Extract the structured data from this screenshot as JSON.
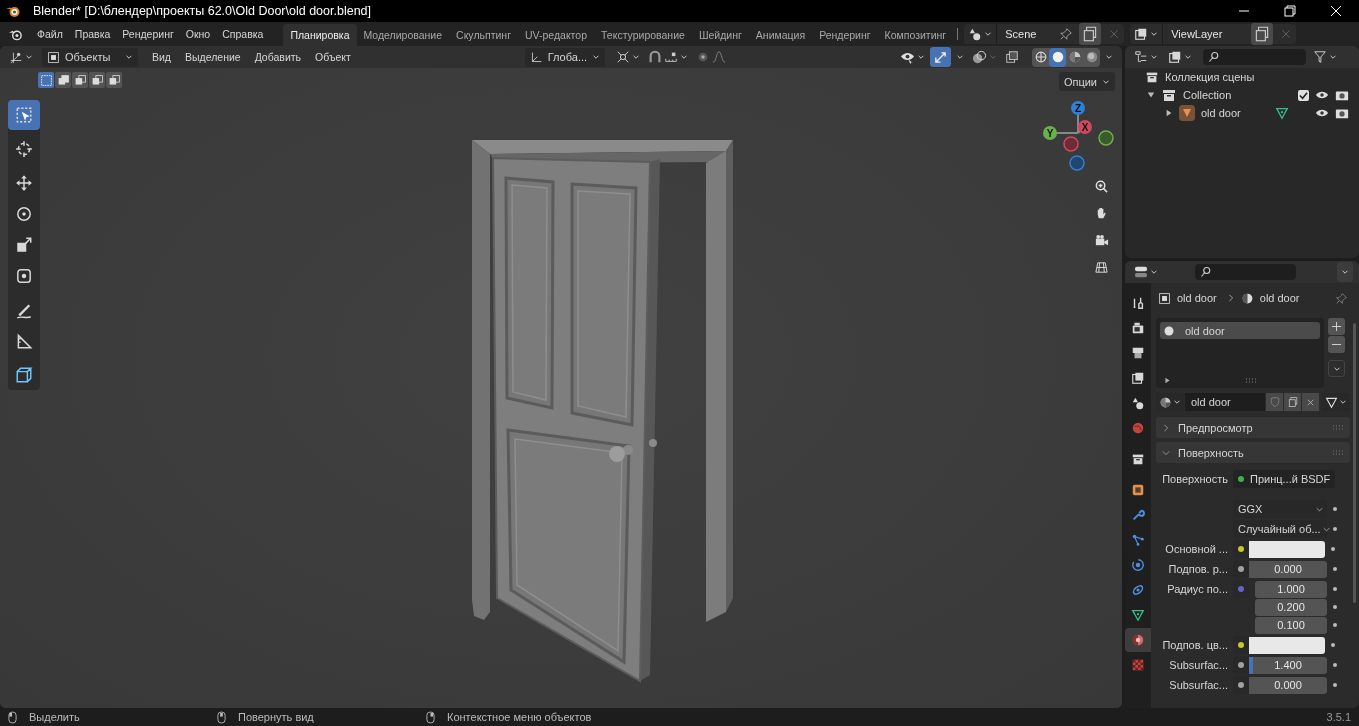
{
  "window": {
    "title": "Blender* [D:\\блендер\\проекты 62.0\\Old Door\\old door.blend]"
  },
  "menu": [
    "Файл",
    "Правка",
    "Рендеринг",
    "Окно",
    "Справка"
  ],
  "workspaces": [
    {
      "label": "Планировка",
      "selected": true
    },
    {
      "label": "Моделирование",
      "selected": false
    },
    {
      "label": "Скульптинг",
      "selected": false
    },
    {
      "label": "UV-редактор",
      "selected": false
    },
    {
      "label": "Текстурирование",
      "selected": false
    },
    {
      "label": "Шейдинг",
      "selected": false
    },
    {
      "label": "Анимация",
      "selected": false
    },
    {
      "label": "Рендеринг",
      "selected": false
    },
    {
      "label": "Композитинг",
      "selected": false
    }
  ],
  "scene": {
    "name": "Scene"
  },
  "view_layer": {
    "name": "ViewLayer"
  },
  "viewport": {
    "mode": "Объекты",
    "menus": [
      "Вид",
      "Выделение",
      "Добавить",
      "Объект"
    ],
    "orientation": "Глоба...",
    "options": "Опции",
    "gizmos_on": true,
    "select_modes": [
      {
        "selected": true
      },
      {
        "selected": false
      },
      {
        "selected": false
      },
      {
        "selected": false
      },
      {
        "selected": false
      }
    ],
    "shading": [
      {
        "kind": "wireframe",
        "selected": false
      },
      {
        "kind": "solid",
        "selected": true
      },
      {
        "kind": "material",
        "selected": false
      },
      {
        "kind": "rendered",
        "selected": false
      }
    ],
    "tools": [
      {
        "kind": "select",
        "selected": true
      },
      {
        "kind": "cursor",
        "selected": false
      },
      {
        "kind": "move",
        "selected": false
      },
      {
        "kind": "rotate",
        "selected": false
      },
      {
        "kind": "scale",
        "selected": false
      },
      {
        "kind": "transform",
        "selected": false
      },
      {
        "kind": "annotate",
        "selected": false
      },
      {
        "kind": "measure",
        "selected": false
      },
      {
        "kind": "add_cube",
        "selected": false
      }
    ],
    "axes": [
      "Z",
      "Y",
      "X"
    ]
  },
  "outliner": {
    "root": "Коллекция сцены",
    "children": [
      {
        "label": "Collection",
        "expanded": true,
        "checked": true,
        "children": [
          {
            "label": "old door",
            "expanded": false
          }
        ]
      }
    ]
  },
  "properties": {
    "tabs": [
      {
        "kind": "tool",
        "selected": false
      },
      {
        "kind": "render",
        "selected": false
      },
      {
        "kind": "output",
        "selected": false
      },
      {
        "kind": "view_layer",
        "selected": false
      },
      {
        "kind": "scene",
        "selected": false
      },
      {
        "kind": "world",
        "selected": false
      },
      {
        "kind": "collection",
        "selected": false
      },
      {
        "kind": "object",
        "selected": false
      },
      {
        "kind": "modifiers",
        "selected": false
      },
      {
        "kind": "particles",
        "selected": false
      },
      {
        "kind": "physics",
        "selected": false
      },
      {
        "kind": "constraints",
        "selected": false
      },
      {
        "kind": "data",
        "selected": false
      },
      {
        "kind": "material",
        "selected": true
      },
      {
        "kind": "texture",
        "selected": false
      }
    ],
    "breadcrumb": [
      "old door",
      "old door"
    ],
    "slots": [
      {
        "label": "old door",
        "selected": true
      }
    ],
    "material": "old door",
    "panels": [
      {
        "label": "Предпросмотр",
        "expanded": false
      },
      {
        "label": "Поверхность",
        "expanded": true
      }
    ],
    "fields": [
      {
        "kind": "link",
        "label": "Поверхность",
        "value": "Принц...й BSDF",
        "color": "#3fae4c"
      },
      {
        "kind": "dropdown",
        "value": "GGX"
      },
      {
        "kind": "dropdown",
        "value": "Случайный об..."
      },
      {
        "kind": "color",
        "label": "Основной ...",
        "color": "#c7c729"
      },
      {
        "kind": "number",
        "label": "Подпов. р...",
        "color": "#a1a1a1",
        "value": "0.000"
      },
      {
        "kind": "vector",
        "label": "Радиус по...",
        "color": "#6363c7",
        "values": [
          "1.000",
          "0.200",
          "0.100"
        ]
      },
      {
        "kind": "color",
        "label": "Подпов. цв...",
        "color": "#c7c729"
      },
      {
        "kind": "slider",
        "label": "Subsurfac...",
        "color": "#a1a1a1",
        "value": "1.400",
        "level": 0.05
      },
      {
        "kind": "number",
        "label": "Subsurfac...",
        "color": "#a1a1a1",
        "value": "0.000"
      }
    ]
  },
  "status_bar": {
    "hints": [
      "Выделить",
      "Повернуть вид",
      "Контекстное меню объектов"
    ],
    "version": "3.5.1"
  }
}
